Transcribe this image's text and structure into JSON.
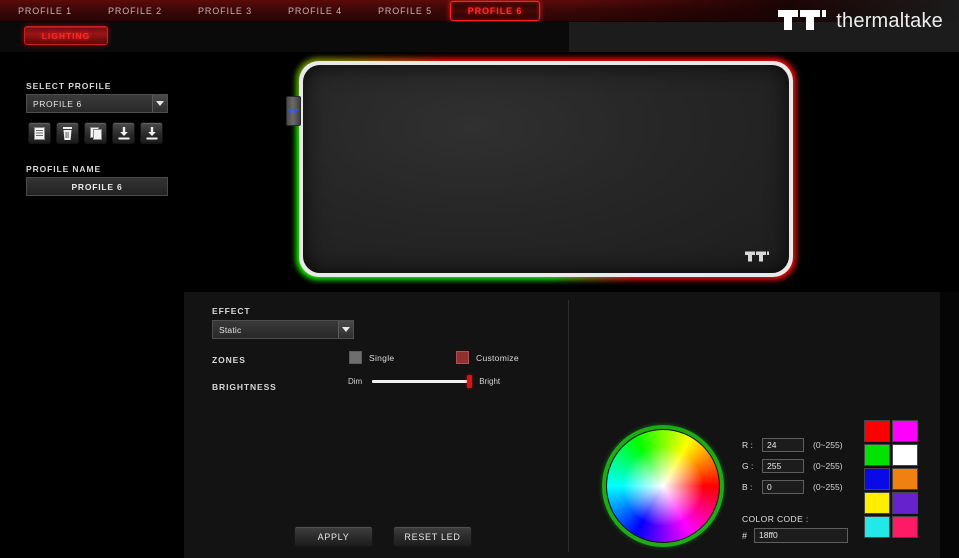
{
  "app": {
    "brand": "thermaltake",
    "logo_icon": "thermaltake-tt-logo"
  },
  "tabs": [
    {
      "label": "PROFILE 1",
      "active": false
    },
    {
      "label": "PROFILE 2",
      "active": false
    },
    {
      "label": "PROFILE 3",
      "active": false
    },
    {
      "label": "PROFILE 4",
      "active": false
    },
    {
      "label": "PROFILE 5",
      "active": false
    },
    {
      "label": "PROFILE 6",
      "active": true
    }
  ],
  "nav": {
    "lighting_label": "LIGHTING"
  },
  "sidebar": {
    "select_profile_label": "SELECT PROFILE",
    "select_profile_value": "PROFILE 6",
    "profile_name_label": "PROFILE NAME",
    "profile_name_value": "PROFILE 6",
    "buttons": [
      {
        "name": "new-profile-icon",
        "title": "New"
      },
      {
        "name": "delete-profile-icon",
        "title": "Delete"
      },
      {
        "name": "copy-profile-icon",
        "title": "Copy"
      },
      {
        "name": "import-profile-icon",
        "title": "Import"
      },
      {
        "name": "export-profile-icon",
        "title": "Export"
      }
    ]
  },
  "preview": {
    "device": "RGB mouse pad",
    "logo_icon": "thermaltake-tt-logo",
    "connector_icon": "usb-connector",
    "edge_colors": {
      "top": "#ff0f0f",
      "bottom": "#19ff00"
    }
  },
  "effect": {
    "label": "EFFECT",
    "value": "Static",
    "zones_label": "ZONES",
    "zone_options": [
      {
        "label": "Single",
        "color": "#6e6e6e",
        "selected": false
      },
      {
        "label": "Customize",
        "color": "#8e3131",
        "selected": true
      }
    ],
    "brightness_label": "BRIGHTNESS",
    "brightness_min_label": "Dim",
    "brightness_max_label": "Bright",
    "brightness_percent": 98
  },
  "actions": {
    "apply_label": "APPLY",
    "reset_label": "RESET LED"
  },
  "color_picker": {
    "r_label": "R :",
    "r_value": "24",
    "g_label": "G :",
    "g_value": "255",
    "b_label": "B :",
    "b_value": "0",
    "range_hint": "(0~255)",
    "color_code_label": "COLOR CODE :",
    "hash": "#",
    "color_code_value": "18ff0",
    "wheel_ring_color": "#1faa18",
    "palette": [
      "#ff0000",
      "#ff00ff",
      "#00e300",
      "#ffffff",
      "#0a0ae6",
      "#f08010",
      "#ffee00",
      "#6622cc",
      "#22e8e8",
      "#ff1a66"
    ]
  }
}
